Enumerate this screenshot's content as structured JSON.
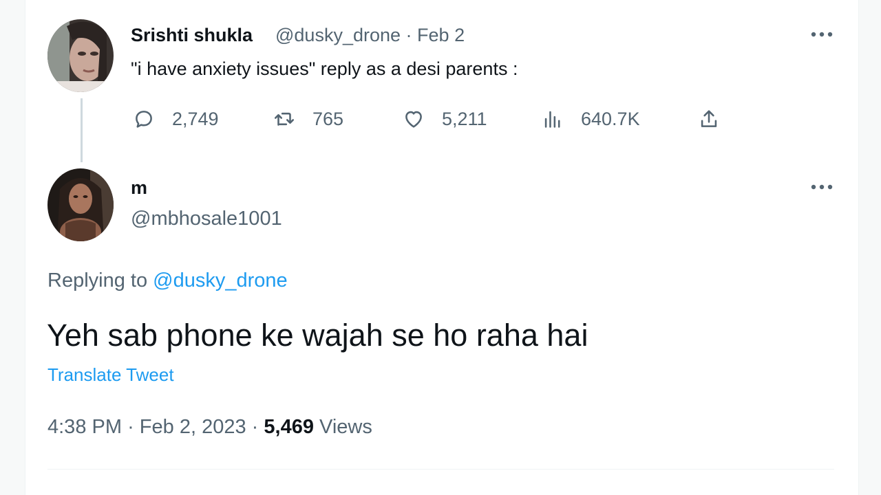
{
  "original_tweet": {
    "display_name": "Srishti shukla",
    "handle": "@dusky_drone",
    "separator": "·",
    "date": "Feb 2",
    "text": "\"i have anxiety issues\" reply as a desi parents :",
    "actions": {
      "replies": "2,749",
      "retweets": "765",
      "likes": "5,211",
      "views": "640.7K"
    }
  },
  "reply_tweet": {
    "display_name": "m",
    "handle": "@mbhosale1001",
    "replying_prefix": "Replying to",
    "replying_handle": "@dusky_drone",
    "text": "Yeh sab phone ke wajah se ho raha hai",
    "translate_label": "Translate Tweet",
    "time": "4:38 PM",
    "date": "Feb 2, 2023",
    "views_count": "5,469",
    "views_label": "Views"
  },
  "icons": {
    "more": "more-horizontal-icon",
    "reply": "reply-bubble-icon",
    "retweet": "retweet-icon",
    "like": "heart-icon",
    "views": "bar-chart-icon",
    "share": "share-upload-icon"
  },
  "colors": {
    "accent": "#1d9bf0",
    "text_primary": "#0f1419",
    "text_secondary": "#536471",
    "divider": "#eff3f4"
  }
}
